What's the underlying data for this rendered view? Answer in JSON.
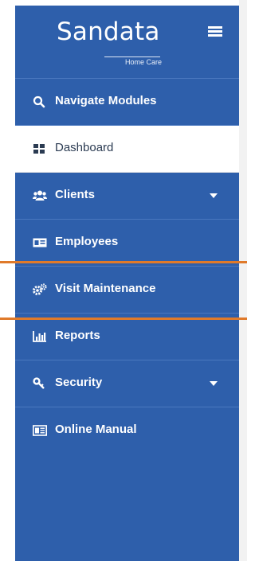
{
  "brand": {
    "name": "Sandata",
    "subtitle": "Home Care"
  },
  "menu": [
    {
      "label": "Navigate Modules",
      "icon": "search-icon",
      "active": false,
      "has_caret": false
    },
    {
      "label": "Dashboard",
      "icon": "dashboard-grid-icon",
      "active": true,
      "has_caret": false
    },
    {
      "label": "Clients",
      "icon": "users-icon",
      "active": false,
      "has_caret": true
    },
    {
      "label": "Employees",
      "icon": "id-card-icon",
      "active": false,
      "has_caret": false
    },
    {
      "label": "Visit Maintenance",
      "icon": "gears-icon",
      "active": false,
      "has_caret": false
    },
    {
      "label": "Reports",
      "icon": "bar-chart-icon",
      "active": false,
      "has_caret": false
    },
    {
      "label": "Security",
      "icon": "key-icon",
      "active": false,
      "has_caret": true
    },
    {
      "label": "Online Manual",
      "icon": "manual-icon",
      "active": false,
      "has_caret": false
    }
  ],
  "colors": {
    "sidebar": "#2e5fab",
    "highlight": "#e07a2a",
    "active_bg": "#ffffff"
  }
}
